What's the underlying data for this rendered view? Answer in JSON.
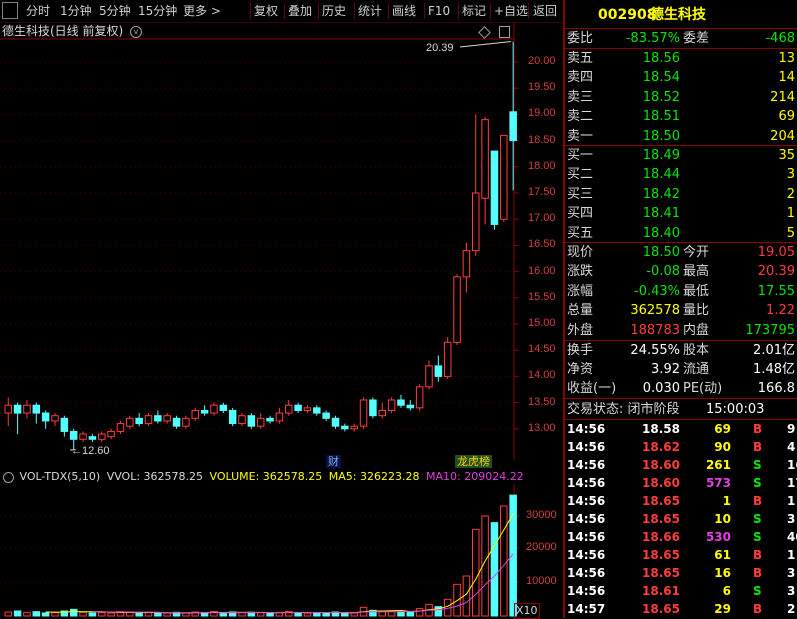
{
  "toolbar": {
    "items": [
      "分时",
      "1分钟",
      "5分钟",
      "15分钟",
      "更多 >",
      "复权",
      "叠加",
      "历史",
      "统计",
      "画线",
      "F10",
      "标记",
      "+自选",
      "返回"
    ]
  },
  "chart": {
    "title": "德生科技(日线 前复权)",
    "high_label": "20.39",
    "low_label": "12.60",
    "y_ticks": [
      "20.00",
      "19.50",
      "19.00",
      "18.50",
      "18.00",
      "17.50",
      "17.00",
      "16.50",
      "16.00",
      "15.50",
      "15.00",
      "14.50",
      "14.00",
      "13.50",
      "13.00"
    ],
    "markers": [
      "财",
      "龙虎榜"
    ],
    "colors": {
      "up": "#ff3c3c",
      "down": "#54ffff",
      "ma5": "#ffff00",
      "ma10": "#e040e0",
      "axis": "#8a0000"
    }
  },
  "volume": {
    "label": "VOL-TDX(5,10)",
    "vvol": "VVOL: 362578.25",
    "volume": "VOLUME: 362578.25",
    "ma5": "MA5: 326223.28",
    "ma10": "MA10: 209024.22",
    "y_ticks": [
      "30000",
      "20000",
      "10000"
    ],
    "unit": "X10"
  },
  "quote": {
    "code": "002908",
    "name": "德生科技",
    "webi_label": "委比",
    "webi_value": "-83.57%",
    "weicha_label": "委差",
    "weicha_value": "-468",
    "asks": [
      {
        "label": "卖五",
        "price": "18.56",
        "vol": "13"
      },
      {
        "label": "卖四",
        "price": "18.54",
        "vol": "14"
      },
      {
        "label": "卖三",
        "price": "18.52",
        "vol": "214"
      },
      {
        "label": "卖二",
        "price": "18.51",
        "vol": "69"
      },
      {
        "label": "卖一",
        "price": "18.50",
        "vol": "204"
      }
    ],
    "bids": [
      {
        "label": "买一",
        "price": "18.49",
        "vol": "35"
      },
      {
        "label": "买二",
        "price": "18.44",
        "vol": "3"
      },
      {
        "label": "买三",
        "price": "18.42",
        "vol": "2"
      },
      {
        "label": "买四",
        "price": "18.41",
        "vol": "1"
      },
      {
        "label": "买五",
        "price": "18.40",
        "vol": "5"
      }
    ],
    "stats": [
      {
        "l1": "现价",
        "v1": "18.50",
        "c1": "green",
        "l2": "今开",
        "v2": "19.05",
        "c2": "red"
      },
      {
        "l1": "涨跌",
        "v1": "-0.08",
        "c1": "green",
        "l2": "最高",
        "v2": "20.39",
        "c2": "red"
      },
      {
        "l1": "涨幅",
        "v1": "-0.43%",
        "c1": "green",
        "l2": "最低",
        "v2": "17.55",
        "c2": "green"
      },
      {
        "l1": "总量",
        "v1": "362578",
        "c1": "yellow",
        "l2": "量比",
        "v2": "1.22",
        "c2": "red"
      },
      {
        "l1": "外盘",
        "v1": "188783",
        "c1": "red",
        "l2": "内盘",
        "v2": "173795",
        "c2": "green"
      }
    ],
    "stats2": [
      {
        "l1": "换手",
        "v1": "24.55%",
        "l2": "股本",
        "v2": "2.01亿"
      },
      {
        "l1": "净资",
        "v1": "3.92",
        "l2": "流通",
        "v2": "1.48亿"
      },
      {
        "l1": "收益(一)",
        "v1": "0.030",
        "l2": "PE(动)",
        "v2": "166.8"
      }
    ],
    "status_label": "交易状态: 闭市阶段",
    "status_time": "15:00:03",
    "trades": [
      {
        "t": "14:56",
        "p": "18.58",
        "pc": "white",
        "v": "69",
        "vc": "yellow",
        "d": "B",
        "n": "9"
      },
      {
        "t": "14:56",
        "p": "18.62",
        "pc": "red",
        "v": "90",
        "vc": "yellow",
        "d": "B",
        "n": "4"
      },
      {
        "t": "14:56",
        "p": "18.60",
        "pc": "red",
        "v": "261",
        "vc": "yellow",
        "d": "S",
        "n": "16"
      },
      {
        "t": "14:56",
        "p": "18.60",
        "pc": "red",
        "v": "573",
        "vc": "magenta",
        "d": "S",
        "n": "17"
      },
      {
        "t": "14:56",
        "p": "18.65",
        "pc": "red",
        "v": "1",
        "vc": "yellow",
        "d": "B",
        "n": "1"
      },
      {
        "t": "14:56",
        "p": "18.65",
        "pc": "red",
        "v": "10",
        "vc": "yellow",
        "d": "S",
        "n": "3"
      },
      {
        "t": "14:56",
        "p": "18.66",
        "pc": "red",
        "v": "530",
        "vc": "magenta",
        "d": "S",
        "n": "40"
      },
      {
        "t": "14:56",
        "p": "18.65",
        "pc": "red",
        "v": "61",
        "vc": "yellow",
        "d": "B",
        "n": "1"
      },
      {
        "t": "14:56",
        "p": "18.65",
        "pc": "red",
        "v": "16",
        "vc": "yellow",
        "d": "B",
        "n": "3"
      },
      {
        "t": "14:56",
        "p": "18.61",
        "pc": "red",
        "v": "6",
        "vc": "yellow",
        "d": "S",
        "n": "3"
      },
      {
        "t": "14:57",
        "p": "18.65",
        "pc": "red",
        "v": "29",
        "vc": "yellow",
        "d": "B",
        "n": "2"
      }
    ]
  }
}
